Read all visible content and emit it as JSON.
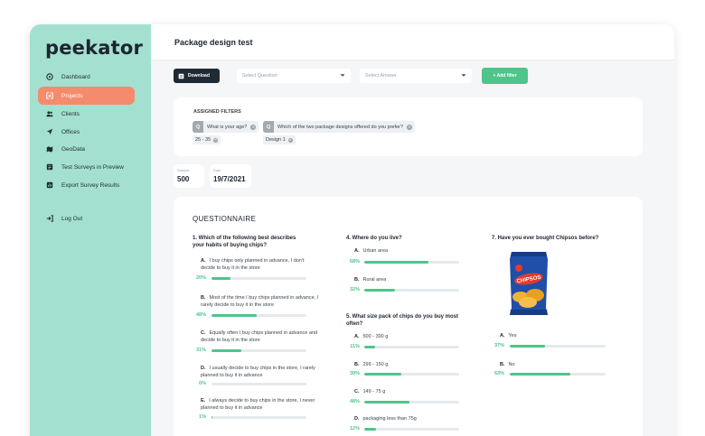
{
  "app": {
    "logo": "peekator",
    "page_title": "Package design test"
  },
  "sidebar": {
    "items": [
      {
        "label": "Dashboard",
        "icon": "dashboard-icon"
      },
      {
        "label": "Projects",
        "icon": "projects-icon",
        "active": true
      },
      {
        "label": "Clients",
        "icon": "clients-icon"
      },
      {
        "label": "Offices",
        "icon": "offices-icon"
      },
      {
        "label": "GeoData",
        "icon": "geodata-icon"
      },
      {
        "label": "Test Surveys in Preview",
        "icon": "survey-preview-icon"
      },
      {
        "label": "Export  Survey Results",
        "icon": "export-icon"
      },
      {
        "label": "Log Out",
        "icon": "logout-icon"
      }
    ]
  },
  "toolbar": {
    "download_label": "Download",
    "select_question_placeholder": "Select Question",
    "select_answer_placeholder": "Select Answer",
    "add_filter_label": "+ Add filter"
  },
  "filters": {
    "title": "ASSIGNED FILTERS",
    "items": [
      {
        "question": "What is your age?",
        "answer": "25 - 35"
      },
      {
        "question": "Which of the two package designs offered do you prefer?",
        "answer": "Design 1"
      }
    ]
  },
  "stats": {
    "sample_label": "Sample",
    "sample_value": "500",
    "date_label": "Date",
    "date_value": "19/7/2021"
  },
  "questionnaire": {
    "title": "QUESTIONNAIRE",
    "questions": [
      {
        "title": "1. Which of the following best describes your habits of buying chips?",
        "options": [
          {
            "letter": "A.",
            "text": "I buy chips only planned in advance, I don't decide to buy it in the store",
            "pct": "20%",
            "value": 0.2
          },
          {
            "letter": "B.",
            "text": "Most of the time I buy chips planned in advance, I rarely decide to buy it in the store",
            "pct": "48%",
            "value": 0.48
          },
          {
            "letter": "C.",
            "text": "Equally often I buy chips planned in advance and decide to buy it in the store",
            "pct": "31%",
            "value": 0.31
          },
          {
            "letter": "D.",
            "text": "I usually decide to buy chips in the store, I rarely planned to buy it in advance",
            "pct": "0%",
            "value": 0.0
          },
          {
            "letter": "E.",
            "text": "I always decide to buy chips in the store, I never planned to buy it in advance",
            "pct": "1%",
            "value": 0.01
          }
        ]
      },
      {
        "title": "4. Where do you live?",
        "options": [
          {
            "letter": "A.",
            "text": "Urban area",
            "pct": "68%",
            "value": 0.68
          },
          {
            "letter": "B.",
            "text": "Rural area",
            "pct": "32%",
            "value": 0.32
          }
        ]
      },
      {
        "title": "5. What size pack of chips do you buy most often?",
        "options": [
          {
            "letter": "A.",
            "text": "500 - 300 g",
            "pct": "11%",
            "value": 0.11
          },
          {
            "letter": "B.",
            "text": "299 - 150 g",
            "pct": "39%",
            "value": 0.39
          },
          {
            "letter": "C.",
            "text": "149 - 75 g",
            "pct": "48%",
            "value": 0.48
          },
          {
            "letter": "D.",
            "text": "packaging less than 75g",
            "pct": "12%",
            "value": 0.12
          }
        ]
      },
      {
        "title": "7. Have you ever bought Chipsos before?",
        "image_brand": "CHIPSOS",
        "options": [
          {
            "letter": "A.",
            "text": "Yes",
            "pct": "37%",
            "value": 0.37
          },
          {
            "letter": "B.",
            "text": "No",
            "pct": "63%",
            "value": 0.63
          }
        ]
      }
    ]
  },
  "colors": {
    "sidebar": "#a3e0d0",
    "active": "#f58b6d",
    "accent": "#4fc48b",
    "dark": "#1f2a35"
  }
}
